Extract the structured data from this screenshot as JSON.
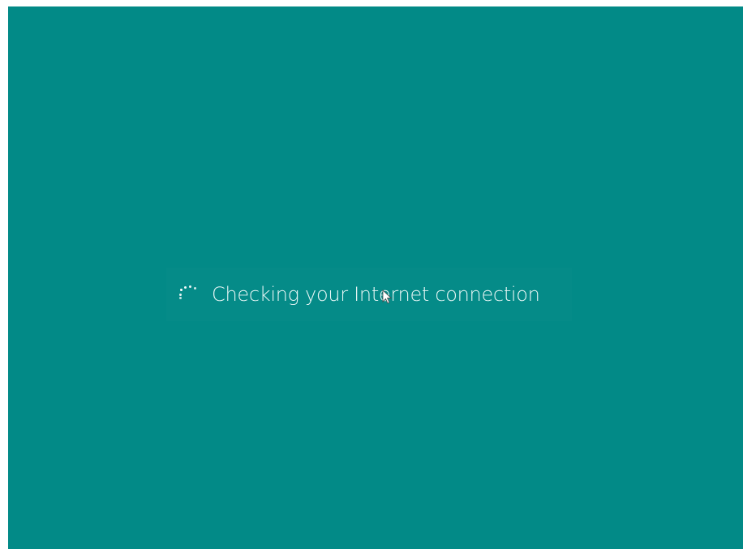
{
  "setup": {
    "status_message": "Checking your Internet connection",
    "background_color": "#028a87",
    "spinner_icon": "loading-dots-icon",
    "cursor_icon": "mouse-pointer-icon"
  }
}
